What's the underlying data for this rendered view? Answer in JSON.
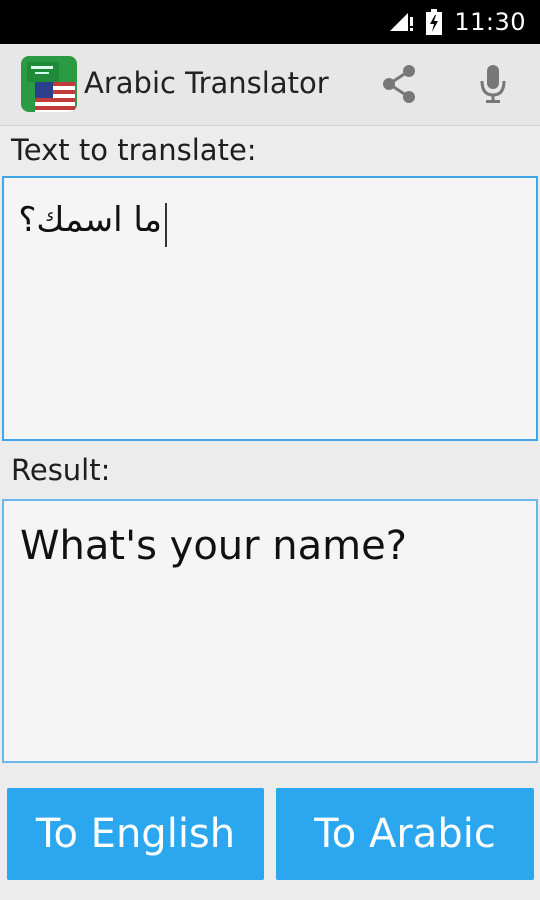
{
  "status_bar": {
    "time": "11:30"
  },
  "action_bar": {
    "title": "Arabic Translator",
    "icons": [
      "app-flag-icon",
      "share-icon",
      "microphone-icon"
    ]
  },
  "input": {
    "label": "Text to translate:",
    "value": "ما اسمك؟"
  },
  "result": {
    "label": "Result:",
    "value": "What's your name?"
  },
  "buttons": {
    "to_english": "To English",
    "to_arabic": "To Arabic"
  },
  "colors": {
    "accent": "#2aa7ef",
    "border": "#41a6e8"
  }
}
